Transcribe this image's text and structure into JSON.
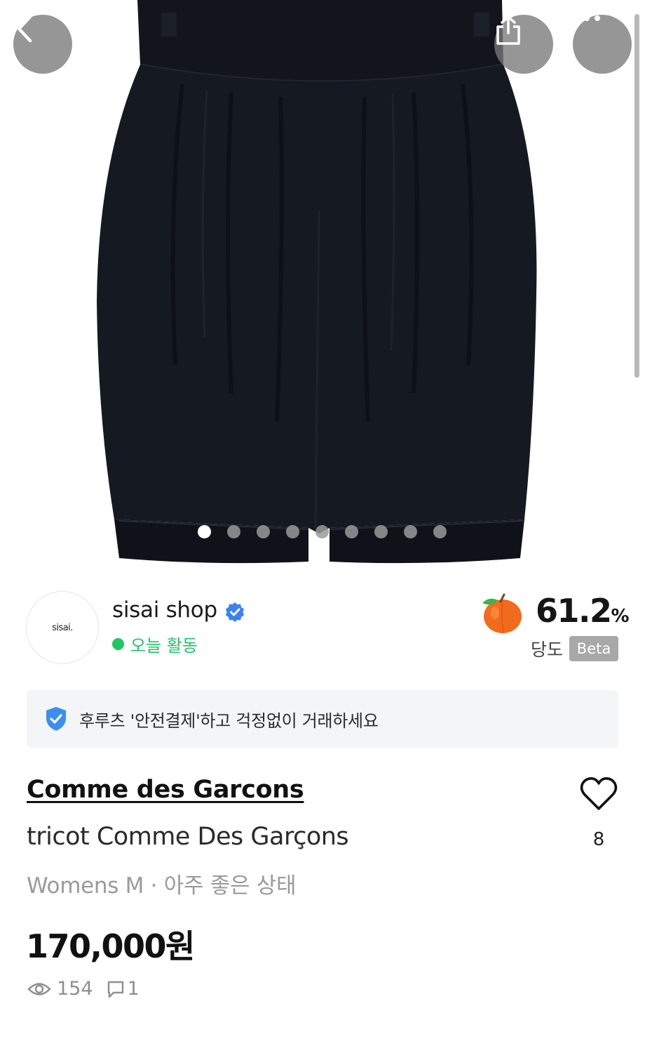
{
  "toolbar": {
    "back_icon": "chevron-left-icon",
    "share_icon": "share-icon",
    "more_icon": "more-horizontal-icon"
  },
  "gallery": {
    "image_count": 9,
    "active_index": 0,
    "subject": "product-photo-black-balloon-shorts"
  },
  "seller": {
    "avatar_text": "sisai.",
    "name": "sisai shop",
    "verified_icon": "verified-check-icon",
    "activity": "오늘 활동",
    "activity_color": "#22c55e"
  },
  "peach": {
    "icon": "peach-icon",
    "score": "61.2",
    "unit": "%",
    "label": "당도",
    "badge": "Beta"
  },
  "banner": {
    "icon": "shield-check-icon",
    "text": "후루츠 '안전결제'하고 걱정없이 거래하세요"
  },
  "product": {
    "brand": "Comme des Garcons",
    "title": "tricot Comme Des Garçons",
    "meta": "Womens M · 아주 좋은 상태",
    "price": "170,000원",
    "likes": "8",
    "views": "154",
    "comments": "1"
  },
  "colors": {
    "accent_green": "#22c55e",
    "verified_blue": "#3b82f6",
    "peach_orange": "#f26b1d"
  }
}
